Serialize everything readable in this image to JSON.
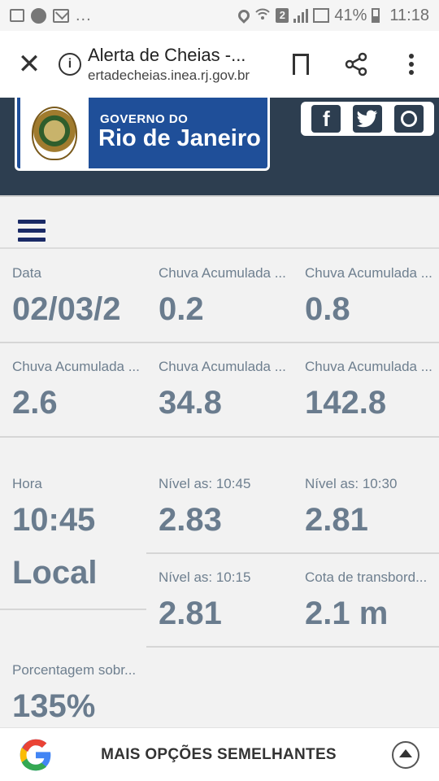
{
  "status_bar": {
    "battery": "41%",
    "time": "11:18",
    "dots": "...",
    "sim_label": "2"
  },
  "browser": {
    "title": "Alerta de Cheias -...",
    "url": "ertadecheias.inea.rj.gov.br",
    "close_glyph": "✕",
    "info_glyph": "i"
  },
  "header": {
    "logo_line1": "GOVERNO DO",
    "logo_line2": "Rio de Janeiro",
    "social": [
      "facebook-icon",
      "twitter-icon",
      "instagram-icon"
    ],
    "facebook_glyph": "f",
    "twitter_glyph": "t"
  },
  "data": {
    "r1": [
      {
        "label": "Data",
        "value": "02/03/2"
      },
      {
        "label": "Chuva Acumulada ...",
        "value": "0.2"
      },
      {
        "label": "Chuva Acumulada ...",
        "value": "0.8"
      }
    ],
    "r2": [
      {
        "label": "Chuva Acumulada ...",
        "value": "2.6"
      },
      {
        "label": "Chuva Acumulada ...",
        "value": "34.8"
      },
      {
        "label": "Chuva Acumulada ...",
        "value": "142.8"
      }
    ],
    "hora": {
      "label": "Hora",
      "value": "10:45",
      "local": "Local"
    },
    "r3": [
      {
        "label": "Nível as: 10:45",
        "value": "2.83"
      },
      {
        "label": "Nível as: 10:30",
        "value": "2.81"
      }
    ],
    "r4": [
      {
        "label": "Nível as: 10:15",
        "value": "2.81"
      },
      {
        "label": "Cota de transbord...",
        "value": "2.1 m"
      }
    ],
    "r5": {
      "label": "Porcentagem sobr...",
      "value": "135%"
    }
  },
  "bottom": {
    "label": "MAIS OPÇÕES SEMELHANTES"
  },
  "colors": {
    "header_bg": "#2d3e50",
    "logo_blue": "#1f4f99",
    "value_text": "#6a7c8e",
    "hamburger": "#1a2a66"
  }
}
